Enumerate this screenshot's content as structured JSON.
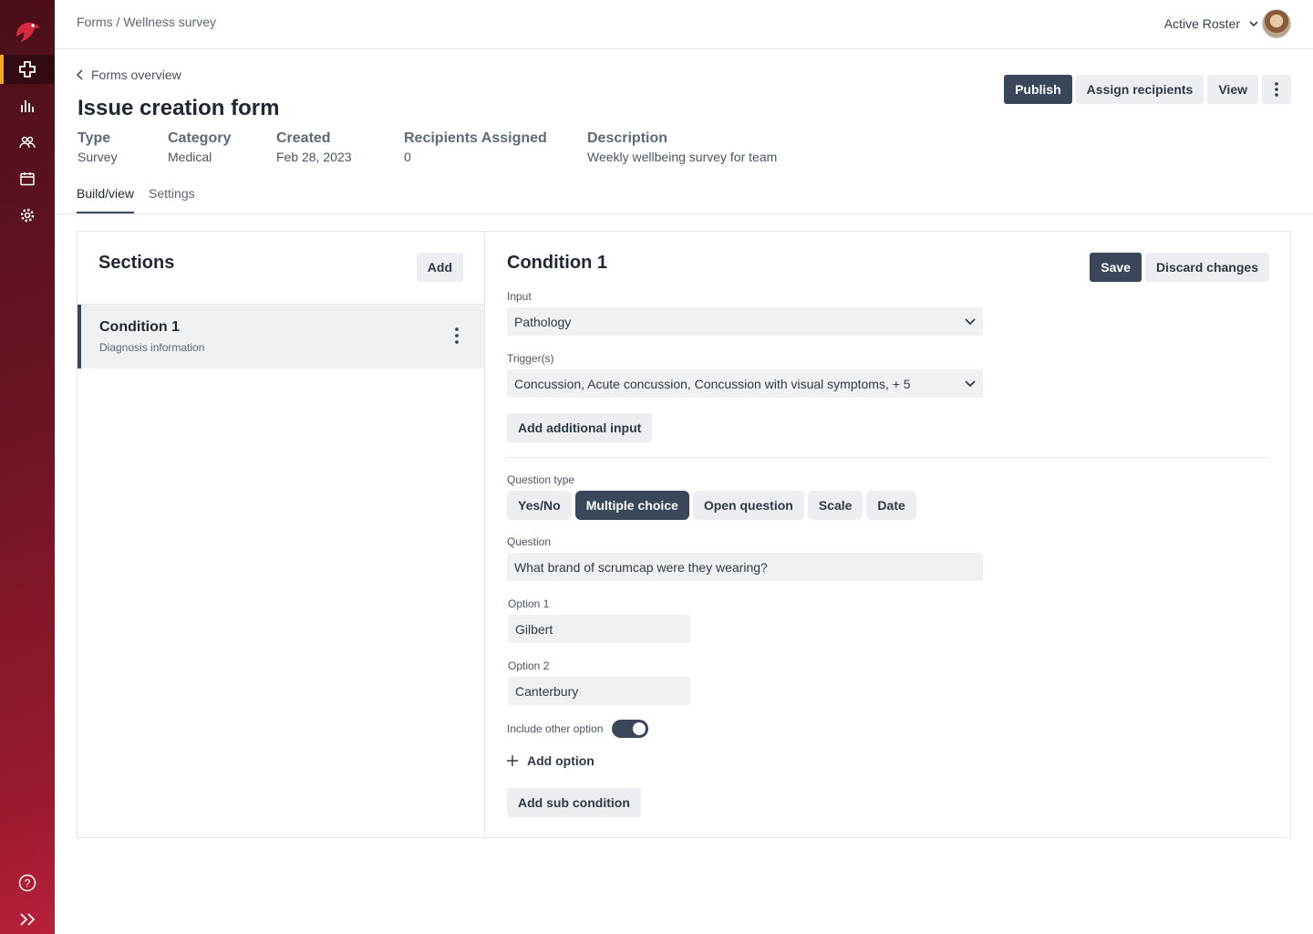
{
  "breadcrumb": "Forms / Wellness survey",
  "roster": {
    "label": "Active Roster"
  },
  "icons": {
    "logo": "bird-logo-icon",
    "nav_medical": "medical-cross-icon",
    "nav_analytics": "bar-chart-icon",
    "nav_people": "people-icon",
    "nav_calendar": "calendar-icon",
    "nav_settings": "gear-icon",
    "help": "help-icon",
    "expand": "double-chevron-right-icon"
  },
  "back_label": "Forms overview",
  "title": "Issue creation form",
  "meta": [
    {
      "key": "Type",
      "value": "Survey"
    },
    {
      "key": "Category",
      "value": "Medical"
    },
    {
      "key": "Created",
      "value": "Feb 28, 2023"
    },
    {
      "key": "Recipients Assigned",
      "value": "0"
    },
    {
      "key": "Description",
      "value": "Weekly wellbeing survey for team"
    }
  ],
  "header_buttons": {
    "publish": "Publish",
    "assign": "Assign recipients",
    "view": "View"
  },
  "tabs": [
    {
      "label": "Build/view",
      "active": true
    },
    {
      "label": "Settings",
      "active": false
    }
  ],
  "sections_panel": {
    "title": "Sections",
    "add_label": "Add",
    "items": [
      {
        "title": "Condition 1",
        "subtitle": "Diagnosis information"
      }
    ]
  },
  "editor": {
    "title": "Condition 1",
    "save_label": "Save",
    "discard_label": "Discard changes",
    "input_label": "Input",
    "input_value": "Pathology",
    "triggers_label": "Trigger(s)",
    "triggers_value": "Concussion, Acute concussion, Concussion with visual symptoms, + 5",
    "add_input_label": "Add additional input",
    "question_type_label": "Question type",
    "question_types": [
      "Yes/No",
      "Multiple choice",
      "Open question",
      "Scale",
      "Date"
    ],
    "question_type_selected": "Multiple choice",
    "question_label": "Question",
    "question_value": "What brand of scrumcap were they wearing?",
    "options": [
      {
        "label": "Option 1",
        "value": "Gilbert"
      },
      {
        "label": "Option 2",
        "value": "Canterbury"
      }
    ],
    "include_other_label": "Include other option",
    "include_other": true,
    "add_option_label": "Add option",
    "add_sub_condition_label": "Add sub condition"
  },
  "colors": {
    "primary": "#3a4659",
    "accent": "#f5a623",
    "sidebar": "#6b1424"
  }
}
